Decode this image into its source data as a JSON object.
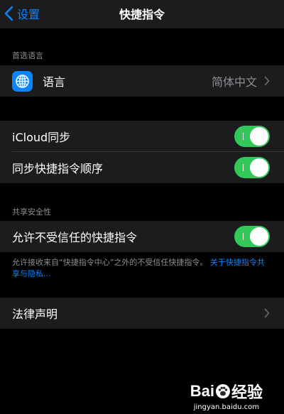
{
  "navbar": {
    "back_label": "设置",
    "title": "快捷指令"
  },
  "language_section": {
    "header": "首选语言",
    "row": {
      "icon": "globe-icon",
      "label": "语言",
      "value": "简体中文"
    }
  },
  "sync_section": {
    "rows": [
      {
        "label": "iCloud同步",
        "toggle_on": true
      },
      {
        "label": "同步快捷指令顺序",
        "toggle_on": true
      }
    ]
  },
  "security_section": {
    "header": "共享安全性",
    "row": {
      "label": "允许不受信任的快捷指令",
      "toggle_on": true
    },
    "footnote": "允许接收来自“快捷指令中心”之外的不受信任快捷指令。",
    "footnote_link": "关于快捷指令共享与隐私..."
  },
  "legal_section": {
    "row": {
      "label": "法律声明"
    }
  },
  "watermark": {
    "logo_left": "Bai",
    "logo_right": "经验",
    "url": "jingyan.baidu.com"
  },
  "colors": {
    "background": "#000000",
    "group_background": "#1c1c1e",
    "accent": "#0a84ff",
    "toggle_on": "#34c759",
    "secondary_text": "#8e8e93"
  }
}
